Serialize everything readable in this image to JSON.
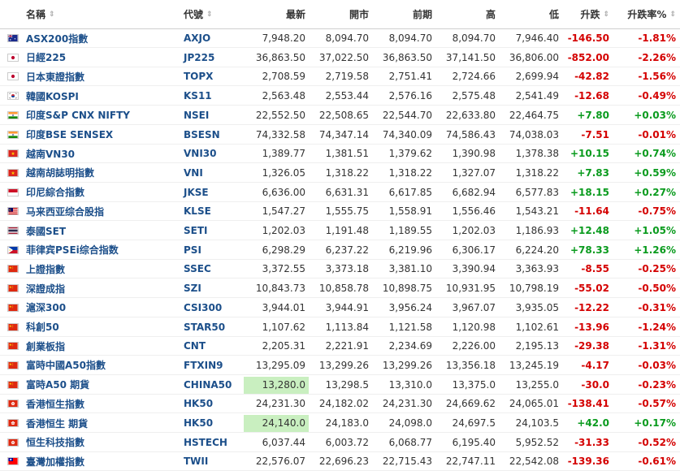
{
  "headers": {
    "name": "名稱",
    "symbol": "代號",
    "last": "最新",
    "open": "開市",
    "prev": "前期",
    "high": "高",
    "low": "低",
    "chg": "升跌",
    "pct": "升跌率%",
    "sort_icon": "⇕"
  },
  "rows": [
    {
      "flag": "australia-flag-icon",
      "name": "ASX200指數",
      "symbol": "AXJO",
      "last": "7,948.20",
      "open": "8,094.70",
      "prev": "8,094.70",
      "high": "8,094.70",
      "low": "7,946.40",
      "chg": "-146.50",
      "pct": "-1.81%",
      "dir": "down",
      "hl": false
    },
    {
      "flag": "japan-flag-icon",
      "name": "日經225",
      "symbol": "JP225",
      "last": "36,863.50",
      "open": "37,022.50",
      "prev": "36,863.50",
      "high": "37,141.50",
      "low": "36,806.00",
      "chg": "-852.00",
      "pct": "-2.26%",
      "dir": "down",
      "hl": false
    },
    {
      "flag": "japan-flag-icon",
      "name": "日本東證指數",
      "symbol": "TOPX",
      "last": "2,708.59",
      "open": "2,719.58",
      "prev": "2,751.41",
      "high": "2,724.66",
      "low": "2,699.94",
      "chg": "-42.82",
      "pct": "-1.56%",
      "dir": "down",
      "hl": false
    },
    {
      "flag": "south-korea-flag-icon",
      "name": "韓國KOSPI",
      "symbol": "KS11",
      "last": "2,563.48",
      "open": "2,553.44",
      "prev": "2,576.16",
      "high": "2,575.48",
      "low": "2,541.49",
      "chg": "-12.68",
      "pct": "-0.49%",
      "dir": "down",
      "hl": false
    },
    {
      "flag": "india-flag-icon",
      "name": "印度S&P CNX NIFTY",
      "symbol": "NSEI",
      "last": "22,552.50",
      "open": "22,508.65",
      "prev": "22,544.70",
      "high": "22,633.80",
      "low": "22,464.75",
      "chg": "+7.80",
      "pct": "+0.03%",
      "dir": "up",
      "hl": false
    },
    {
      "flag": "india-flag-icon",
      "name": "印度BSE SENSEX",
      "symbol": "BSESN",
      "last": "74,332.58",
      "open": "74,347.14",
      "prev": "74,340.09",
      "high": "74,586.43",
      "low": "74,038.03",
      "chg": "-7.51",
      "pct": "-0.01%",
      "dir": "down",
      "hl": false
    },
    {
      "flag": "vietnam-flag-icon",
      "name": "越南VN30",
      "symbol": "VNI30",
      "last": "1,389.77",
      "open": "1,381.51",
      "prev": "1,379.62",
      "high": "1,390.98",
      "low": "1,378.38",
      "chg": "+10.15",
      "pct": "+0.74%",
      "dir": "up",
      "hl": false
    },
    {
      "flag": "vietnam-flag-icon",
      "name": "越南胡誌明指數",
      "symbol": "VNI",
      "last": "1,326.05",
      "open": "1,318.22",
      "prev": "1,318.22",
      "high": "1,327.07",
      "low": "1,318.22",
      "chg": "+7.83",
      "pct": "+0.59%",
      "dir": "up",
      "hl": false
    },
    {
      "flag": "indonesia-flag-icon",
      "name": "印尼綜合指數",
      "symbol": "JKSE",
      "last": "6,636.00",
      "open": "6,631.31",
      "prev": "6,617.85",
      "high": "6,682.94",
      "low": "6,577.83",
      "chg": "+18.15",
      "pct": "+0.27%",
      "dir": "up",
      "hl": false
    },
    {
      "flag": "malaysia-flag-icon",
      "name": "马来西亚综合股指",
      "symbol": "KLSE",
      "last": "1,547.27",
      "open": "1,555.75",
      "prev": "1,558.91",
      "high": "1,556.46",
      "low": "1,543.21",
      "chg": "-11.64",
      "pct": "-0.75%",
      "dir": "down",
      "hl": false
    },
    {
      "flag": "thailand-flag-icon",
      "name": "泰國SET",
      "symbol": "SETI",
      "last": "1,202.03",
      "open": "1,191.48",
      "prev": "1,189.55",
      "high": "1,202.03",
      "low": "1,186.93",
      "chg": "+12.48",
      "pct": "+1.05%",
      "dir": "up",
      "hl": false
    },
    {
      "flag": "philippines-flag-icon",
      "name": "菲律宾PSEi综合指数",
      "symbol": "PSI",
      "last": "6,298.29",
      "open": "6,237.22",
      "prev": "6,219.96",
      "high": "6,306.17",
      "low": "6,224.20",
      "chg": "+78.33",
      "pct": "+1.26%",
      "dir": "up",
      "hl": false
    },
    {
      "flag": "china-flag-icon",
      "name": "上證指數",
      "symbol": "SSEC",
      "last": "3,372.55",
      "open": "3,373.18",
      "prev": "3,381.10",
      "high": "3,390.94",
      "low": "3,363.93",
      "chg": "-8.55",
      "pct": "-0.25%",
      "dir": "down",
      "hl": false
    },
    {
      "flag": "china-flag-icon",
      "name": "深證成指",
      "symbol": "SZI",
      "last": "10,843.73",
      "open": "10,858.78",
      "prev": "10,898.75",
      "high": "10,931.95",
      "low": "10,798.19",
      "chg": "-55.02",
      "pct": "-0.50%",
      "dir": "down",
      "hl": false
    },
    {
      "flag": "china-flag-icon",
      "name": "滬深300",
      "symbol": "CSI300",
      "last": "3,944.01",
      "open": "3,944.91",
      "prev": "3,956.24",
      "high": "3,967.07",
      "low": "3,935.05",
      "chg": "-12.22",
      "pct": "-0.31%",
      "dir": "down",
      "hl": false
    },
    {
      "flag": "china-flag-icon",
      "name": "科創50",
      "symbol": "STAR50",
      "last": "1,107.62",
      "open": "1,113.84",
      "prev": "1,121.58",
      "high": "1,120.98",
      "low": "1,102.61",
      "chg": "-13.96",
      "pct": "-1.24%",
      "dir": "down",
      "hl": false
    },
    {
      "flag": "china-flag-icon",
      "name": "創業板指",
      "symbol": "CNT",
      "last": "2,205.31",
      "open": "2,221.91",
      "prev": "2,234.69",
      "high": "2,226.00",
      "low": "2,195.13",
      "chg": "-29.38",
      "pct": "-1.31%",
      "dir": "down",
      "hl": false
    },
    {
      "flag": "china-flag-icon",
      "name": "富時中國A50指數",
      "symbol": "FTXIN9",
      "last": "13,295.09",
      "open": "13,299.26",
      "prev": "13,299.26",
      "high": "13,356.18",
      "low": "13,245.19",
      "chg": "-4.17",
      "pct": "-0.03%",
      "dir": "down",
      "hl": false
    },
    {
      "flag": "china-flag-icon",
      "name": "富時A50 期貨",
      "symbol": "CHINA50",
      "last": "13,280.0",
      "open": "13,298.5",
      "prev": "13,310.0",
      "high": "13,375.0",
      "low": "13,255.0",
      "chg": "-30.0",
      "pct": "-0.23%",
      "dir": "down",
      "hl": true
    },
    {
      "flag": "hong-kong-flag-icon",
      "name": "香港恒生指數",
      "symbol": "HK50",
      "last": "24,231.30",
      "open": "24,182.02",
      "prev": "24,231.30",
      "high": "24,669.62",
      "low": "24,065.01",
      "chg": "-138.41",
      "pct": "-0.57%",
      "dir": "down",
      "hl": false
    },
    {
      "flag": "hong-kong-flag-icon",
      "name": "香港恒生 期貨",
      "symbol": "HK50",
      "last": "24,140.0",
      "open": "24,183.0",
      "prev": "24,098.0",
      "high": "24,697.5",
      "low": "24,103.5",
      "chg": "+42.0",
      "pct": "+0.17%",
      "dir": "up",
      "hl": true
    },
    {
      "flag": "hong-kong-flag-icon",
      "name": "恒生科技指數",
      "symbol": "HSTECH",
      "last": "6,037.44",
      "open": "6,003.72",
      "prev": "6,068.77",
      "high": "6,195.40",
      "low": "5,952.52",
      "chg": "-31.33",
      "pct": "-0.52%",
      "dir": "down",
      "hl": false
    },
    {
      "flag": "taiwan-flag-icon",
      "name": "臺灣加權指數",
      "symbol": "TWII",
      "last": "22,576.07",
      "open": "22,696.23",
      "prev": "22,715.43",
      "high": "22,747.11",
      "low": "22,542.08",
      "chg": "-139.36",
      "pct": "-0.61%",
      "dir": "down",
      "hl": false
    }
  ],
  "colors": {
    "up": "#0a9b1e",
    "down": "#d40000",
    "link": "#1c4f8a",
    "highlight": "#c9efc0"
  }
}
